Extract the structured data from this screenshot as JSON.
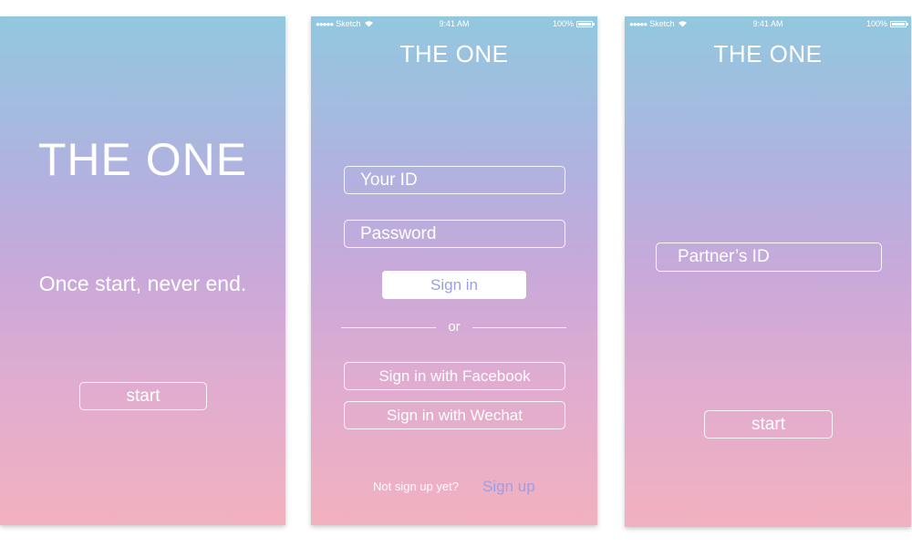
{
  "status_bar": {
    "carrier": "Sketch",
    "time": "9:41 AM",
    "battery": "100%"
  },
  "splash": {
    "title": "THE ONE",
    "tagline": "Once start, never end.",
    "start_label": "start"
  },
  "login": {
    "title": "THE ONE",
    "id_placeholder": "Your ID",
    "password_placeholder": "Password",
    "sign_in_label": "Sign in",
    "or_label": "or",
    "facebook_label": "Sign in with Facebook",
    "wechat_label": "Sign in with Wechat",
    "not_signed_up_text": "Not sign up yet?",
    "sign_up_label": "Sign up"
  },
  "partner": {
    "title": "THE ONE",
    "partner_id_placeholder": "Partner’s ID",
    "start_label": "start"
  },
  "colors": {
    "gradient_top": "#92c8df",
    "gradient_mid": "#c8a9da",
    "gradient_bottom": "#f2b1bf",
    "accent": "#9c9fe4"
  }
}
